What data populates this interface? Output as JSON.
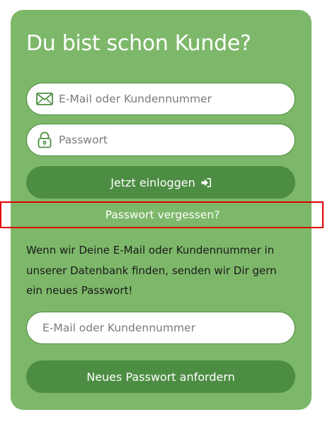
{
  "login": {
    "title": "Du bist schon Kunde?",
    "email_placeholder": "E-Mail oder Kundennummer",
    "password_placeholder": "Passwort",
    "login_button": "Jetzt einloggen",
    "icons": {
      "email": "envelope-icon",
      "password": "lock-icon",
      "login": "sign-in-icon"
    }
  },
  "forgot": {
    "link_label": "Passwort vergessen?",
    "info_text": "Wenn wir Deine E-Mail oder Kundennummer in unserer Datenbank finden, senden wir Dir gern ein neues Passwort!",
    "email_placeholder": "E-Mail oder Kundennummer",
    "request_button": "Neues Passwort anfordern"
  },
  "colors": {
    "card_bg": "#7db86a",
    "button_bg": "#4d8d43",
    "highlight": "#e00000"
  }
}
